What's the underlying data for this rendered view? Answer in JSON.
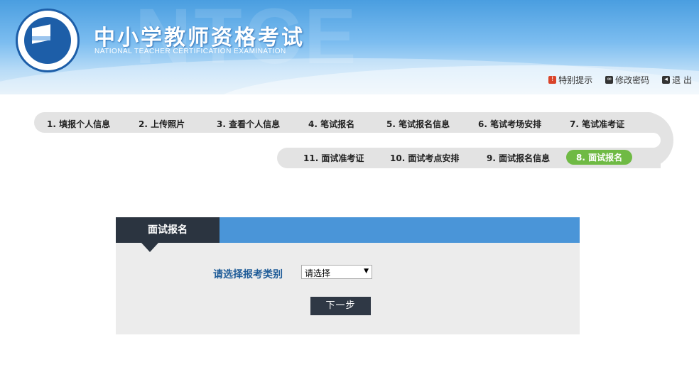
{
  "header": {
    "title_cn": "中小学教师资格考试",
    "title_en": "NATIONAL TEACHER CERTIFICATION EXAMINATION",
    "bg_text": "NTCE",
    "links": [
      {
        "icon": "notice-icon",
        "label": "特别提示"
      },
      {
        "icon": "password-icon",
        "label": "修改密码"
      },
      {
        "icon": "logout-icon",
        "label": "退 出"
      }
    ]
  },
  "steps_row1": [
    "1. 填报个人信息",
    "2. 上传照片",
    "3. 查看个人信息",
    "4. 笔试报名",
    "5. 笔试报名信息",
    "6. 笔试考场安排",
    "7. 笔试准考证"
  ],
  "steps_row2": [
    "11. 面试准考证",
    "10. 面试考点安排",
    "9. 面试报名信息",
    "8. 面试报名"
  ],
  "active_step": "8. 面试报名",
  "panel": {
    "tab_title": "面试报名",
    "field_label": "请选择报考类别",
    "select_value": "请选择",
    "next_label": "下一步"
  },
  "colors": {
    "active_step": "#6fba44",
    "panel_header": "#4a95d8",
    "tab_dark": "#2b3440",
    "label_blue": "#1f5c98"
  }
}
